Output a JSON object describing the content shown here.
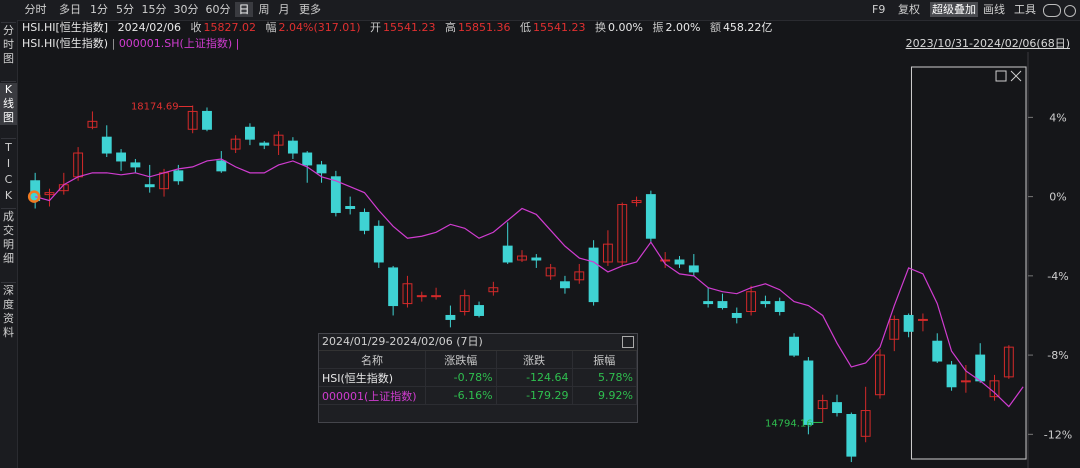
{
  "toolbar": {
    "periods": [
      "分时",
      "多日",
      "1分",
      "5分",
      "15分",
      "30分",
      "60分",
      "日",
      "周",
      "月",
      "更多"
    ],
    "active_period": "日",
    "right": [
      "F9",
      "复权",
      "超级叠加",
      "画线",
      "工具"
    ],
    "active_right": "超级叠加"
  },
  "sidebar": [
    "分时图",
    "K线图",
    "TICK",
    "成交明细",
    "深度资料"
  ],
  "sidebar_active": "K线图",
  "info": {
    "name": "HSI.HI[恒生指数]",
    "date": "2024/02/06",
    "close_label": "收",
    "close": "15827.02",
    "change_label": "幅",
    "change": "2.04%(317.01)",
    "open_label": "开",
    "open": "15541.23",
    "high_label": "高",
    "high": "15851.36",
    "low_label": "低",
    "low": "15541.23",
    "turnover_label": "换",
    "turnover": "0.00%",
    "amplitude_label": "振",
    "amplitude": "2.00%",
    "amount_label": "额",
    "amount": "458.22亿"
  },
  "legend": {
    "main": "HSI.HI(恒生指数)",
    "overlay": "000001.SH(上证指数)"
  },
  "range_label": "2023/10/31-2024/02/06(68日)",
  "colors": {
    "up": "#d42a2a",
    "down": "#3fd3d3",
    "overlay": "#d03cd0",
    "pos_text": "#e03030",
    "neg_text": "#2fbf4f",
    "grid": "#2a2b30"
  },
  "popup": {
    "title": "2024/01/29-2024/02/06 (7日)",
    "headers": [
      "名称",
      "涨跌幅",
      "涨跌",
      "振幅"
    ],
    "rows": [
      {
        "name": "HSI(恒生指数)",
        "pct": "-0.78%",
        "chg": "-124.64",
        "amp": "5.78%"
      },
      {
        "name": "000001(上证指数)",
        "pct": "-6.16%",
        "chg": "-179.29",
        "amp": "9.92%"
      }
    ]
  },
  "chart_data": {
    "type": "candlestick",
    "y_axis_labels": [
      "4%",
      "0%",
      "-4%",
      "-8%",
      "-12%"
    ],
    "y_axis_values": [
      4,
      0,
      -4,
      -8,
      -12
    ],
    "ylim": [
      -13.7,
      7.3
    ],
    "annotations": [
      {
        "text": "18174.69",
        "at_index": 11,
        "kind": "high"
      },
      {
        "text": "14794.16",
        "at_index": 55,
        "kind": "low"
      }
    ],
    "candles": [
      {
        "o": 0.8,
        "c": -0.2,
        "h": 1.2,
        "l": -0.6
      },
      {
        "o": 0.1,
        "c": 0.2,
        "h": 0.4,
        "l": -0.5
      },
      {
        "o": 0.3,
        "c": 0.6,
        "h": 1.2,
        "l": 0.1
      },
      {
        "o": 1.0,
        "c": 2.2,
        "h": 2.5,
        "l": 0.8
      },
      {
        "o": 3.5,
        "c": 3.8,
        "h": 4.3,
        "l": 3.4
      },
      {
        "o": 3.0,
        "c": 2.2,
        "h": 3.6,
        "l": 2.0
      },
      {
        "o": 2.2,
        "c": 1.8,
        "h": 2.4,
        "l": 1.3
      },
      {
        "o": 1.7,
        "c": 1.5,
        "h": 1.9,
        "l": 1.2
      },
      {
        "o": 0.6,
        "c": 0.5,
        "h": 1.6,
        "l": 0.2
      },
      {
        "o": 0.4,
        "c": 1.2,
        "h": 1.4,
        "l": 0.0
      },
      {
        "o": 1.3,
        "c": 0.8,
        "h": 1.6,
        "l": 0.6
      },
      {
        "o": 3.4,
        "c": 4.3,
        "h": 4.6,
        "l": 3.2
      },
      {
        "o": 4.3,
        "c": 3.4,
        "h": 4.5,
        "l": 3.3
      },
      {
        "o": 1.8,
        "c": 1.3,
        "h": 2.3,
        "l": 1.2
      },
      {
        "o": 2.4,
        "c": 2.9,
        "h": 3.1,
        "l": 2.2
      },
      {
        "o": 3.5,
        "c": 2.9,
        "h": 3.7,
        "l": 2.6
      },
      {
        "o": 2.7,
        "c": 2.6,
        "h": 2.8,
        "l": 2.4
      },
      {
        "o": 2.6,
        "c": 3.1,
        "h": 3.3,
        "l": 2.1
      },
      {
        "o": 2.8,
        "c": 2.2,
        "h": 3.0,
        "l": 1.9
      },
      {
        "o": 2.2,
        "c": 1.6,
        "h": 2.3,
        "l": 0.7
      },
      {
        "o": 1.6,
        "c": 1.2,
        "h": 1.8,
        "l": 0.7
      },
      {
        "o": 1.0,
        "c": -0.8,
        "h": 1.3,
        "l": -1.0
      },
      {
        "o": -0.5,
        "c": -0.6,
        "h": 0.0,
        "l": -0.9
      },
      {
        "o": -0.8,
        "c": -1.7,
        "h": -0.6,
        "l": -1.9
      },
      {
        "o": -1.5,
        "c": -3.3,
        "h": -1.2,
        "l": -3.6
      },
      {
        "o": -3.6,
        "c": -5.5,
        "h": -3.5,
        "l": -6.0
      },
      {
        "o": -5.4,
        "c": -4.4,
        "h": -4.0,
        "l": -5.6
      },
      {
        "o": -5.0,
        "c": -5.0,
        "h": -4.8,
        "l": -5.3
      },
      {
        "o": -5.0,
        "c": -5.0,
        "h": -4.6,
        "l": -5.2
      },
      {
        "o": -6.0,
        "c": -6.2,
        "h": -5.5,
        "l": -6.6
      },
      {
        "o": -5.8,
        "c": -5.0,
        "h": -4.7,
        "l": -6.0
      },
      {
        "o": -5.5,
        "c": -6.0,
        "h": -5.3,
        "l": -6.1
      },
      {
        "o": -4.8,
        "c": -4.6,
        "h": -4.3,
        "l": -5.0
      },
      {
        "o": -2.5,
        "c": -3.3,
        "h": -1.3,
        "l": -3.4
      },
      {
        "o": -3.2,
        "c": -3.0,
        "h": -2.7,
        "l": -3.3
      },
      {
        "o": -3.1,
        "c": -3.2,
        "h": -2.9,
        "l": -3.6
      },
      {
        "o": -4.0,
        "c": -3.6,
        "h": -3.4,
        "l": -4.2
      },
      {
        "o": -4.3,
        "c": -4.6,
        "h": -4.0,
        "l": -4.9
      },
      {
        "o": -4.2,
        "c": -3.8,
        "h": -3.4,
        "l": -4.4
      },
      {
        "o": -2.6,
        "c": -5.3,
        "h": -2.2,
        "l": -5.5
      },
      {
        "o": -3.3,
        "c": -2.4,
        "h": -1.7,
        "l": -3.5
      },
      {
        "o": -3.3,
        "c": -0.4,
        "h": -0.3,
        "l": -3.5
      },
      {
        "o": -0.3,
        "c": -0.2,
        "h": 0.0,
        "l": -0.5
      },
      {
        "o": 0.1,
        "c": -2.1,
        "h": 0.3,
        "l": -2.3
      },
      {
        "o": -3.2,
        "c": -3.2,
        "h": -2.8,
        "l": -3.6
      },
      {
        "o": -3.2,
        "c": -3.4,
        "h": -3.0,
        "l": -3.6
      },
      {
        "o": -3.5,
        "c": -3.8,
        "h": -2.9,
        "l": -4.0
      },
      {
        "o": -5.3,
        "c": -5.4,
        "h": -4.6,
        "l": -5.6
      },
      {
        "o": -5.3,
        "c": -5.6,
        "h": -4.9,
        "l": -5.7
      },
      {
        "o": -5.9,
        "c": -6.1,
        "h": -5.6,
        "l": -6.4
      },
      {
        "o": -5.8,
        "c": -4.8,
        "h": -4.5,
        "l": -6.0
      },
      {
        "o": -5.3,
        "c": -5.4,
        "h": -5.0,
        "l": -5.6
      },
      {
        "o": -5.3,
        "c": -5.8,
        "h": -5.1,
        "l": -6.0
      },
      {
        "o": -7.1,
        "c": -8.0,
        "h": -6.9,
        "l": -8.1
      },
      {
        "o": -8.3,
        "c": -11.5,
        "h": -8.1,
        "l": -12.0
      },
      {
        "o": -10.7,
        "c": -10.3,
        "h": -10.0,
        "l": -11.4
      },
      {
        "o": -10.4,
        "c": -10.9,
        "h": -10.0,
        "l": -11.1
      },
      {
        "o": -11.0,
        "c": -13.1,
        "h": -10.9,
        "l": -13.4
      },
      {
        "o": -12.1,
        "c": -10.8,
        "h": -9.6,
        "l": -12.4
      },
      {
        "o": -10.0,
        "c": -8.0,
        "h": -7.7,
        "l": -10.2
      },
      {
        "o": -7.2,
        "c": -6.2,
        "h": -6.0,
        "l": -7.8
      },
      {
        "o": -6.0,
        "c": -6.8,
        "h": -5.9,
        "l": -7.1
      },
      {
        "o": -6.2,
        "c": -6.2,
        "h": -5.9,
        "l": -6.8
      },
      {
        "o": -7.3,
        "c": -8.3,
        "h": -6.9,
        "l": -8.4
      },
      {
        "o": -8.5,
        "c": -9.6,
        "h": -8.3,
        "l": -9.8
      },
      {
        "o": -9.3,
        "c": -9.3,
        "h": -8.5,
        "l": -9.9
      },
      {
        "o": -8.0,
        "c": -9.3,
        "h": -7.4,
        "l": -9.4
      },
      {
        "o": -10.1,
        "c": -9.3,
        "h": -9.0,
        "l": -10.3
      },
      {
        "o": -9.1,
        "c": -7.6,
        "h": -7.5,
        "l": -9.2
      }
    ],
    "overlay": [
      0.0,
      -0.2,
      0.6,
      1.0,
      1.2,
      1.2,
      1.1,
      1.2,
      1.0,
      1.2,
      1.4,
      1.5,
      1.8,
      1.9,
      1.5,
      1.2,
      1.2,
      1.6,
      1.8,
      1.5,
      1.0,
      0.8,
      0.5,
      0.2,
      -0.7,
      -1.5,
      -2.1,
      -2.0,
      -1.8,
      -1.4,
      -1.6,
      -2.1,
      -1.8,
      -1.2,
      -0.6,
      -0.9,
      -1.7,
      -2.5,
      -3.1,
      -3.3,
      -3.8,
      -3.5,
      -3.3,
      -2.3,
      -3.4,
      -3.9,
      -4.0,
      -4.6,
      -4.8,
      -4.9,
      -4.6,
      -4.4,
      -4.7,
      -5.3,
      -5.5,
      -6.0,
      -7.4,
      -8.6,
      -8.4,
      -7.6,
      -5.5,
      -3.6,
      -3.9,
      -5.4,
      -7.8,
      -8.8,
      -9.3,
      -9.9,
      -10.6,
      -9.6
    ]
  }
}
